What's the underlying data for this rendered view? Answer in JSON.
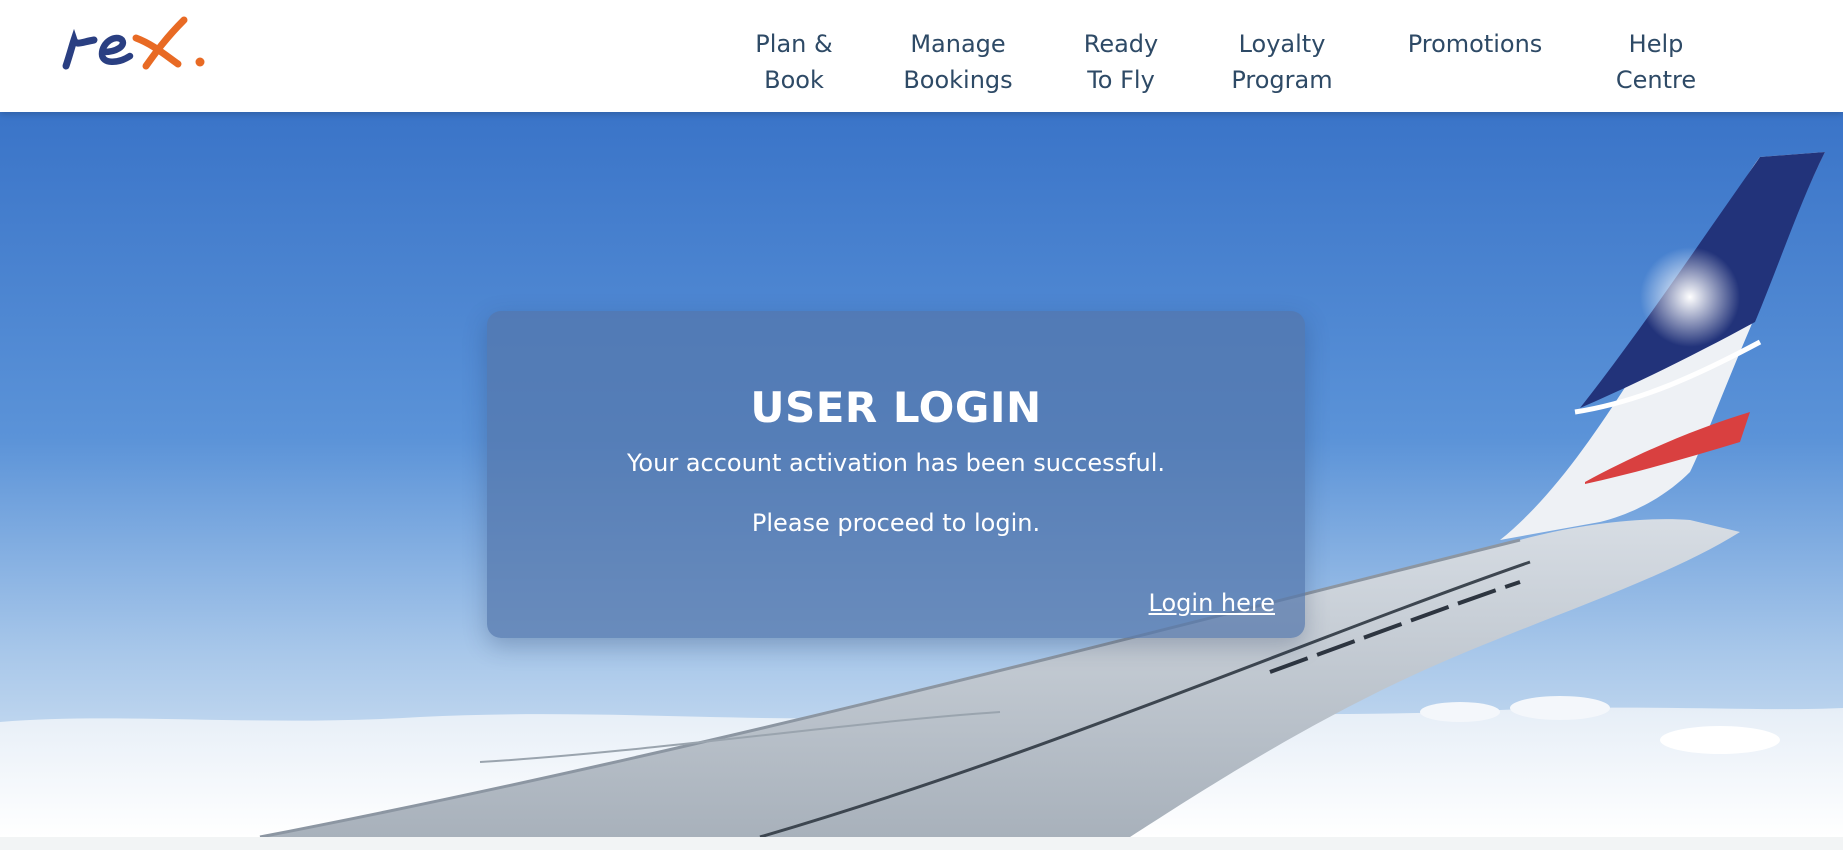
{
  "brand": {
    "logo_text": "rex.",
    "colors": {
      "logo_primary": "#2a3f82",
      "logo_accent": "#e86a24",
      "nav_text": "#2e4a66"
    }
  },
  "nav": {
    "items": [
      {
        "line1": "Plan &",
        "line2": "Book"
      },
      {
        "line1": "Manage",
        "line2": "Bookings"
      },
      {
        "line1": "Ready",
        "line2": "To Fly"
      },
      {
        "line1": "Loyalty",
        "line2": "Program"
      },
      {
        "line1": "Promotions",
        "line2": ""
      },
      {
        "line1": "Help",
        "line2": "Centre"
      }
    ]
  },
  "login_card": {
    "title": "USER LOGIN",
    "message_1": "Your account activation has been successful.",
    "message_2": "Please proceed to login.",
    "link_label": "Login here"
  }
}
